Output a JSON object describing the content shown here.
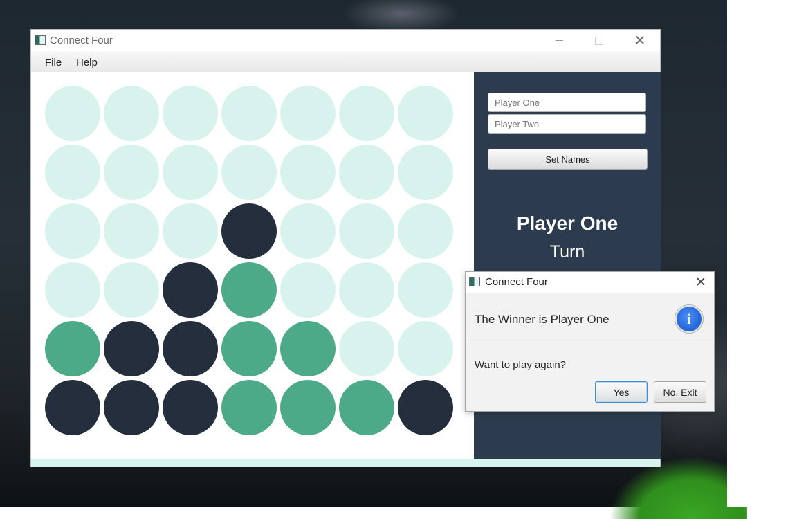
{
  "window": {
    "title": "Connect Four"
  },
  "menu": {
    "file_label": "File",
    "help_label": "Help"
  },
  "board": {
    "rows": [
      [
        "empty",
        "empty",
        "empty",
        "empty",
        "empty",
        "empty",
        "empty"
      ],
      [
        "empty",
        "empty",
        "empty",
        "empty",
        "empty",
        "empty",
        "empty"
      ],
      [
        "empty",
        "empty",
        "empty",
        "dark",
        "empty",
        "empty",
        "empty"
      ],
      [
        "empty",
        "empty",
        "dark",
        "green",
        "empty",
        "empty",
        "empty"
      ],
      [
        "green",
        "dark",
        "dark",
        "green",
        "green",
        "empty",
        "empty"
      ],
      [
        "dark",
        "dark",
        "dark",
        "green",
        "green",
        "green",
        "dark"
      ]
    ],
    "colors": {
      "empty": "#d8f3ed",
      "dark": "#242e3c",
      "green": "#4caa88"
    }
  },
  "side_panel": {
    "player_one_placeholder": "Player One",
    "player_two_placeholder": "Player Two",
    "set_names_label": "Set Names",
    "current_player": "Player One",
    "turn_label": "Turn",
    "background": "#2c3c4e"
  },
  "dialog": {
    "title": "Connect Four",
    "header_text": "The Winner is Player One",
    "content_text": "Want to play again?",
    "yes_label": "Yes",
    "no_label": "No, Exit",
    "icon": "info-icon"
  }
}
